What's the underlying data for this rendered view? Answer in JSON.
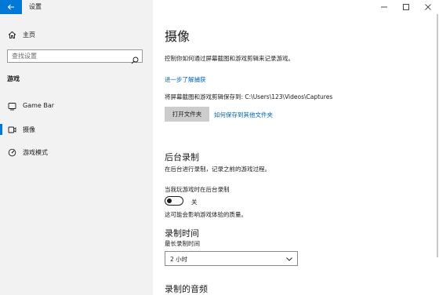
{
  "window": {
    "title": "设置"
  },
  "sidebar": {
    "home_label": "主页",
    "search": {
      "placeholder": "查找设置",
      "value": ""
    },
    "section_heading": "游戏",
    "items": [
      {
        "label": "Game Bar",
        "icon": "game-bar-icon",
        "selected": false
      },
      {
        "label": "摄像",
        "icon": "capture-icon",
        "selected": true
      },
      {
        "label": "游戏模式",
        "icon": "game-mode-icon",
        "selected": false
      }
    ]
  },
  "main": {
    "page_title": "摄像",
    "description": "控制你如何通过屏幕截图和游戏剪辑来记录游戏。",
    "learn_more_link": "进一步了解捕获",
    "save_location_text": "将屏幕截图和游戏剪辑保存到: C:\\Users\\123\\Videos\\Captures",
    "open_folder_button": "打开文件夹",
    "save_elsewhere_link": "如何保存到其他文件夹",
    "background_recording": {
      "heading": "后台录制",
      "description": "在后台进行录制，记录之前的游戏过程。",
      "toggle_label": "当我玩游戏时在后台录制",
      "toggle_state_text": "关",
      "toggle_on": false,
      "note": "这可能会影响游戏体验的质量。"
    },
    "recording_time": {
      "heading": "录制时间",
      "max_length_label": "最长录制时间",
      "selected_value": "2 小时"
    },
    "recorded_audio": {
      "heading": "录制的音频"
    }
  },
  "colors": {
    "accent": "#0078d7",
    "link": "#0063b1",
    "sidebar_bg": "#f2f2f2",
    "button_bg": "#cccccc"
  }
}
